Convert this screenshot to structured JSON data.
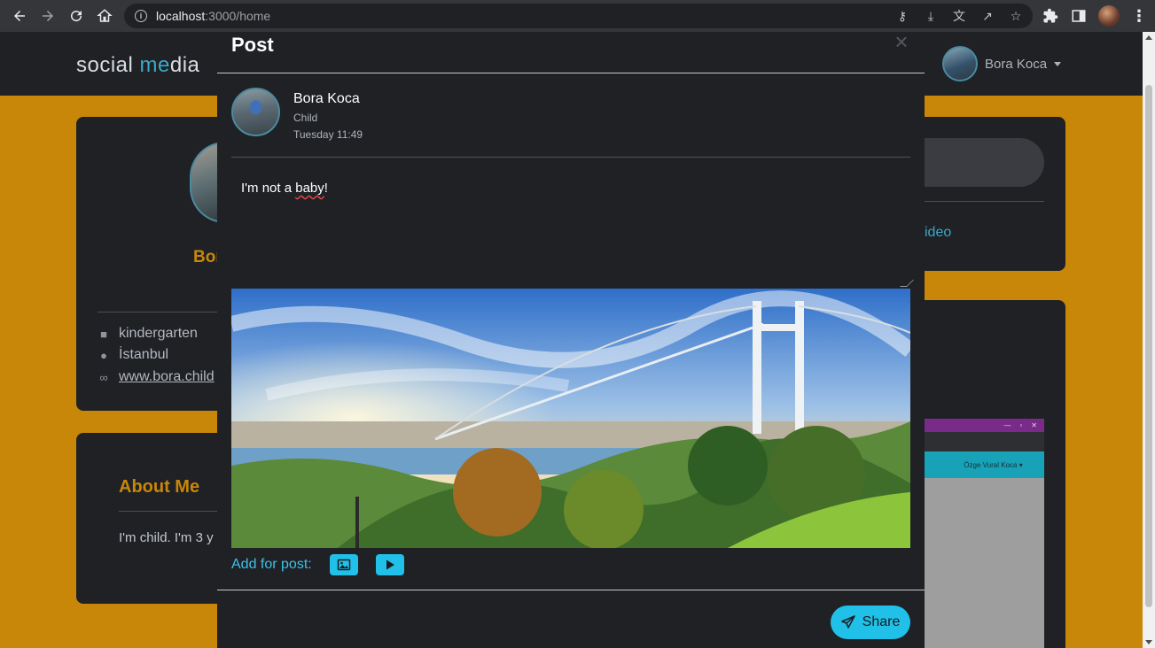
{
  "browser": {
    "url_host": "localhost",
    "url_path": ":3000/home",
    "icons": [
      "back-icon",
      "forward-icon",
      "reload-icon",
      "home-icon",
      "info-icon",
      "key-icon",
      "install-icon",
      "translate-icon",
      "share-icon",
      "star-icon",
      "extensions-icon",
      "sidepanel-icon",
      "profile-avatar",
      "menu-icon"
    ]
  },
  "navbar": {
    "brand_pre": "social ",
    "brand_accent": "me",
    "brand_post": "dia",
    "user_name": "Bora Koca"
  },
  "profile": {
    "name": "Bor",
    "work": "kindergarten",
    "location": "İstanbul",
    "website": "www.bora.child"
  },
  "about": {
    "title": "About Me",
    "text": "I'm child. I'm 3 y"
  },
  "right": {
    "video_label": "ideo",
    "mini_user": "Özge Vural Koca"
  },
  "modal": {
    "title": "Post",
    "close": "×",
    "author_name": "Bora Koca",
    "author_role": "Child",
    "timestamp": "Tuesday 11:49",
    "post_text_before": "I'm not a ",
    "post_text_misspelled": "baby",
    "post_text_after": "!",
    "add_label": "Add for post:",
    "share_label": "Share"
  },
  "colors": {
    "accent": "#20c0e8",
    "brand_accent": "#3aa9c9",
    "gold": "#c9870a",
    "panel": "#1f2125"
  }
}
